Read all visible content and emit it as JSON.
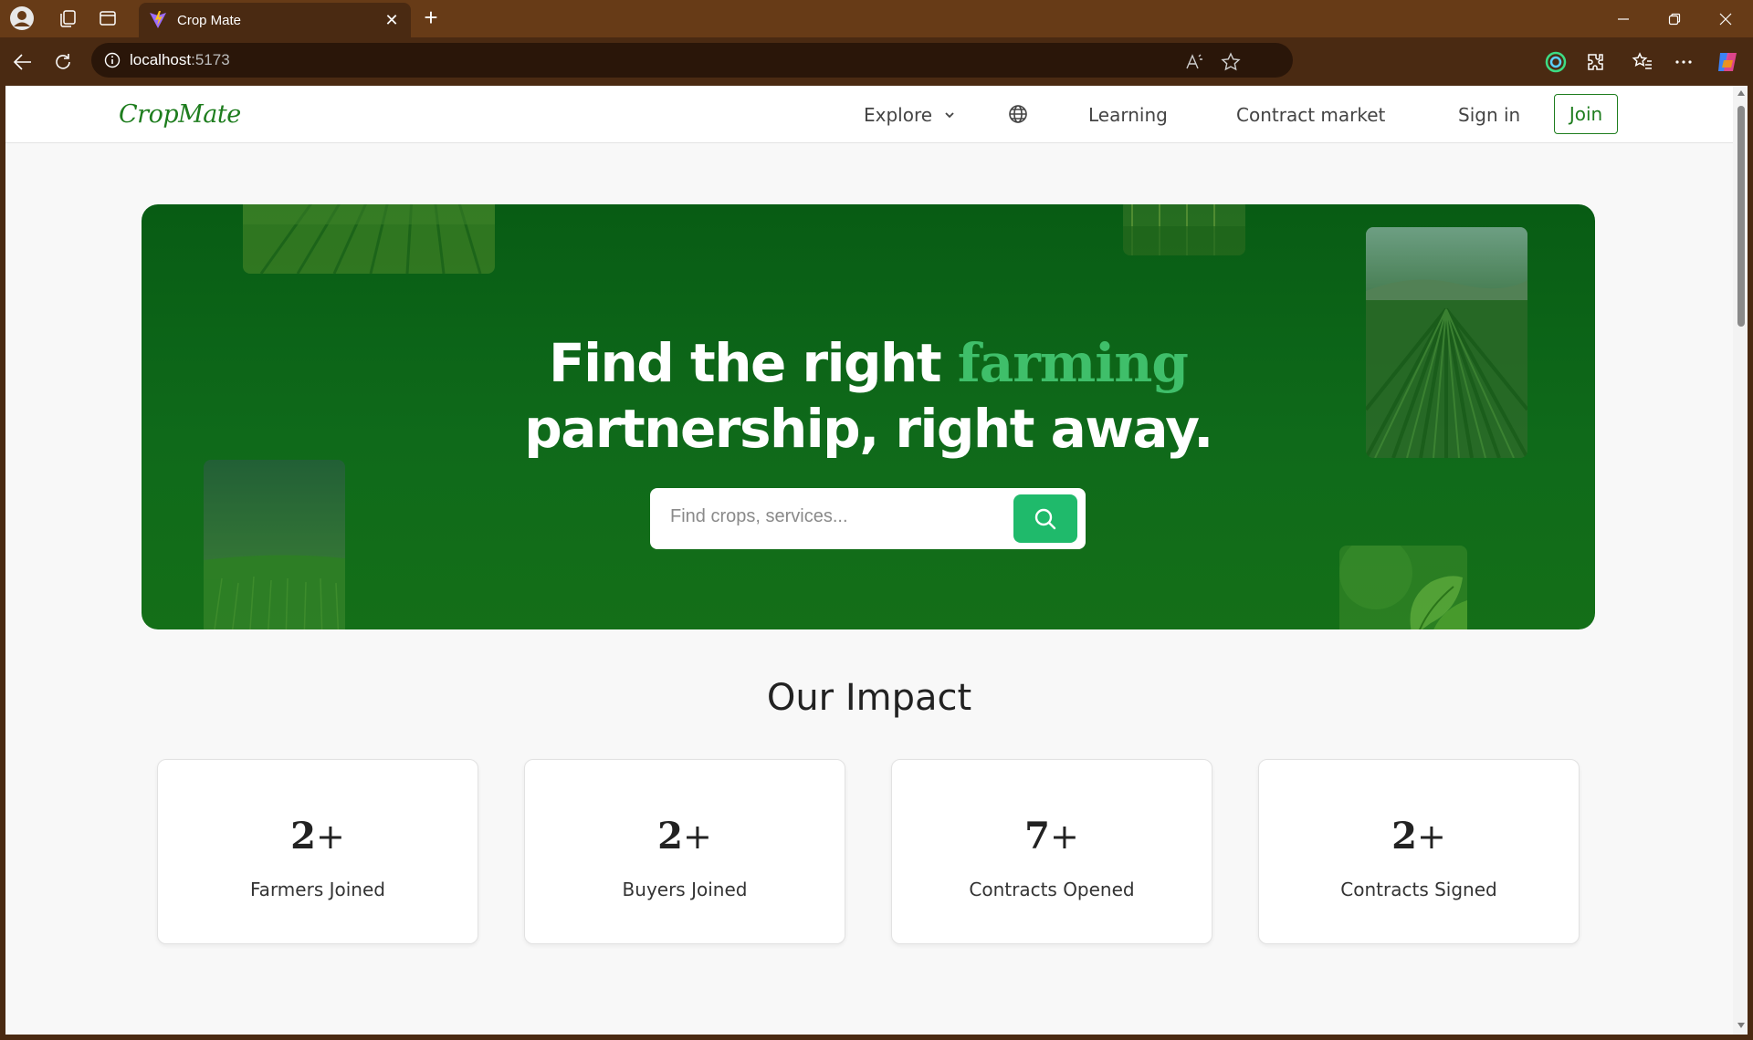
{
  "browser": {
    "tab_title": "Crop Mate",
    "address_host": "localhost",
    "address_port": ":5173"
  },
  "navbar": {
    "logo": "CropMate",
    "explore_label": "Explore",
    "learning_label": "Learning",
    "contract_market_label": "Contract market",
    "sign_in_label": "Sign in",
    "join_label": "Join"
  },
  "hero": {
    "title_part1": "Find the right ",
    "title_accent": "farming",
    "title_line2": "partnership, right away.",
    "search_placeholder": "Find crops, services..."
  },
  "impact": {
    "heading": "Our Impact",
    "stats": [
      {
        "value": "2",
        "suffix": "+",
        "label": "Farmers Joined"
      },
      {
        "value": "2",
        "suffix": "+",
        "label": "Buyers Joined"
      },
      {
        "value": "7",
        "suffix": "+",
        "label": "Contracts Opened"
      },
      {
        "value": "2",
        "suffix": "+",
        "label": "Contracts Signed"
      }
    ]
  },
  "colors": {
    "brand_green": "#1e7d1e",
    "hero_green": "#0f6a1a",
    "accent_green": "#3fbf6a",
    "search_button": "#1fba6b"
  }
}
